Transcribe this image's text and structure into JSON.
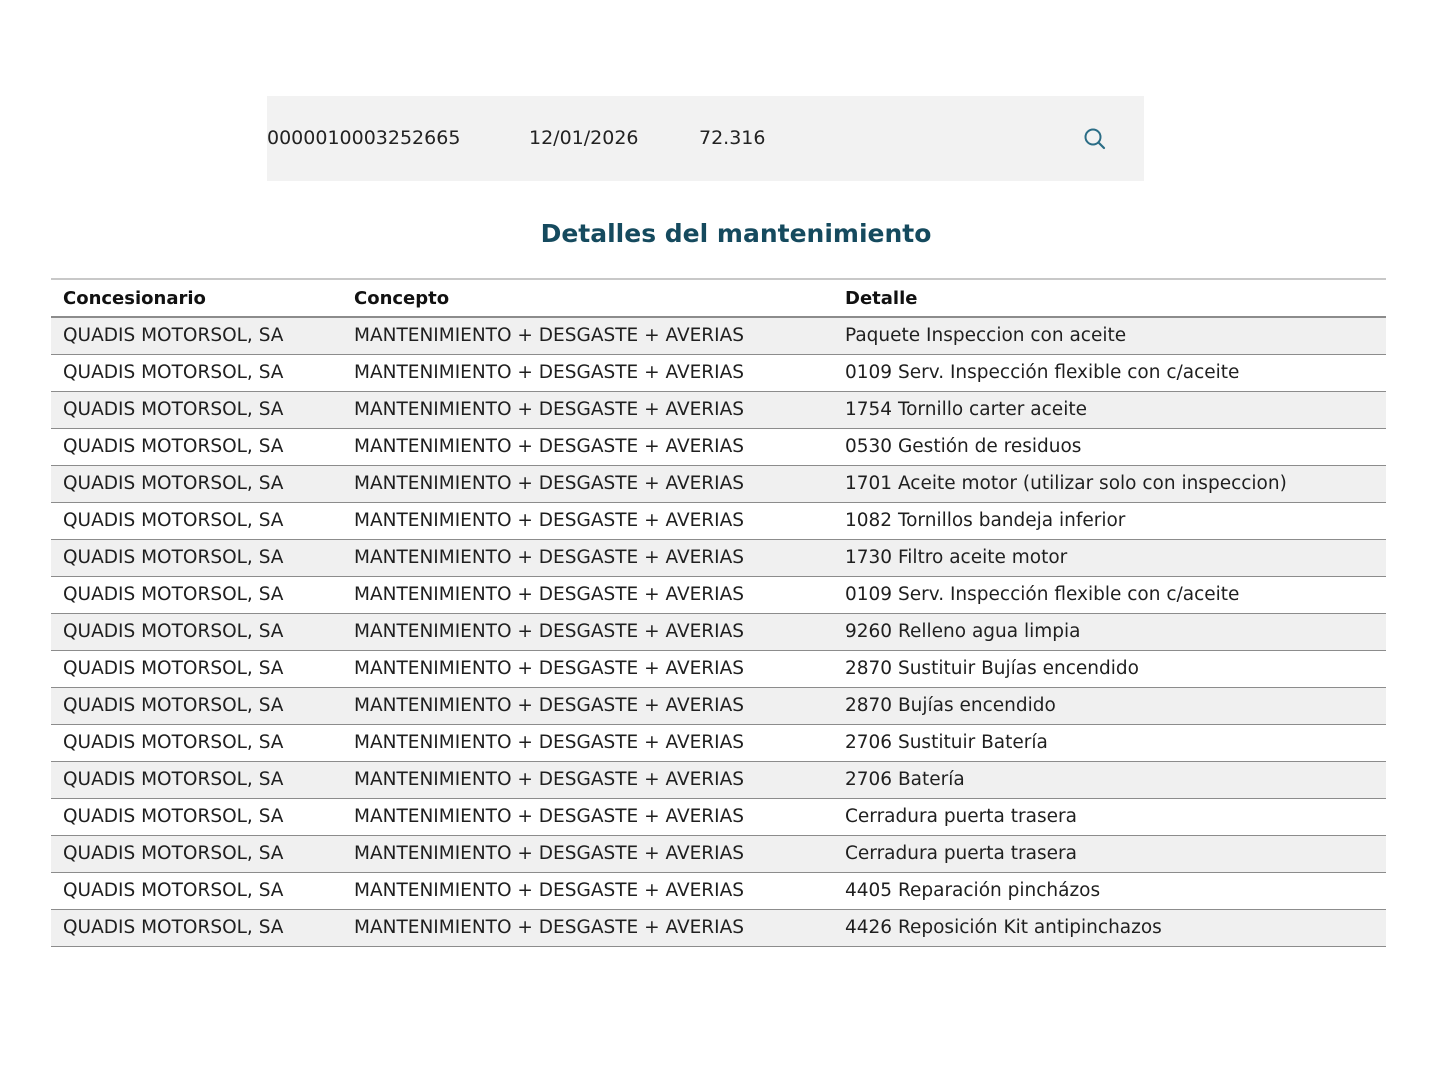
{
  "summary": {
    "order_id": "0000010003252665",
    "date": "12/01/2026",
    "km": "72.316",
    "search_icon": "search-icon"
  },
  "page_title": "Detalles del mantenimiento",
  "table": {
    "headers": [
      "Concesionario",
      "Concepto",
      "Detalle"
    ],
    "rows": [
      [
        "QUADIS MOTORSOL, SA",
        "MANTENIMIENTO + DESGASTE + AVERIAS",
        "Paquete Inspeccion con aceite"
      ],
      [
        "QUADIS MOTORSOL, SA",
        "MANTENIMIENTO + DESGASTE + AVERIAS",
        "0109 Serv. Inspección flexible con c/aceite"
      ],
      [
        "QUADIS MOTORSOL, SA",
        "MANTENIMIENTO + DESGASTE + AVERIAS",
        "1754 Tornillo carter aceite"
      ],
      [
        "QUADIS MOTORSOL, SA",
        "MANTENIMIENTO + DESGASTE + AVERIAS",
        "0530 Gestión de residuos"
      ],
      [
        "QUADIS MOTORSOL, SA",
        "MANTENIMIENTO + DESGASTE + AVERIAS",
        "1701 Aceite motor (utilizar solo con inspeccion)"
      ],
      [
        "QUADIS MOTORSOL, SA",
        "MANTENIMIENTO + DESGASTE + AVERIAS",
        "1082 Tornillos bandeja inferior"
      ],
      [
        "QUADIS MOTORSOL, SA",
        "MANTENIMIENTO + DESGASTE + AVERIAS",
        "1730 Filtro aceite motor"
      ],
      [
        "QUADIS MOTORSOL, SA",
        "MANTENIMIENTO + DESGASTE + AVERIAS",
        "0109 Serv. Inspección flexible con c/aceite"
      ],
      [
        "QUADIS MOTORSOL, SA",
        "MANTENIMIENTO + DESGASTE + AVERIAS",
        "9260 Relleno agua limpia"
      ],
      [
        "QUADIS MOTORSOL, SA",
        "MANTENIMIENTO + DESGASTE + AVERIAS",
        "2870 Sustituir Bujías encendido"
      ],
      [
        "QUADIS MOTORSOL, SA",
        "MANTENIMIENTO + DESGASTE + AVERIAS",
        "2870 Bujías encendido"
      ],
      [
        "QUADIS MOTORSOL, SA",
        "MANTENIMIENTO + DESGASTE + AVERIAS",
        "2706 Sustituir Batería"
      ],
      [
        "QUADIS MOTORSOL, SA",
        "MANTENIMIENTO + DESGASTE + AVERIAS",
        "2706 Batería"
      ],
      [
        "QUADIS MOTORSOL, SA",
        "MANTENIMIENTO + DESGASTE + AVERIAS",
        "Cerradura puerta trasera"
      ],
      [
        "QUADIS MOTORSOL, SA",
        "MANTENIMIENTO + DESGASTE + AVERIAS",
        "Cerradura puerta trasera"
      ],
      [
        "QUADIS MOTORSOL, SA",
        "MANTENIMIENTO + DESGASTE + AVERIAS",
        "4405 Reparación pincházos"
      ],
      [
        "QUADIS MOTORSOL, SA",
        "MANTENIMIENTO + DESGASTE + AVERIAS",
        "4426 Reposición Kit antipinchazos"
      ]
    ]
  },
  "colors": {
    "title": "#154a5e",
    "search_icon": "#2b6d86",
    "summary_bg": "#f2f2f2",
    "row_alt_bg": "#f0f0f0"
  }
}
